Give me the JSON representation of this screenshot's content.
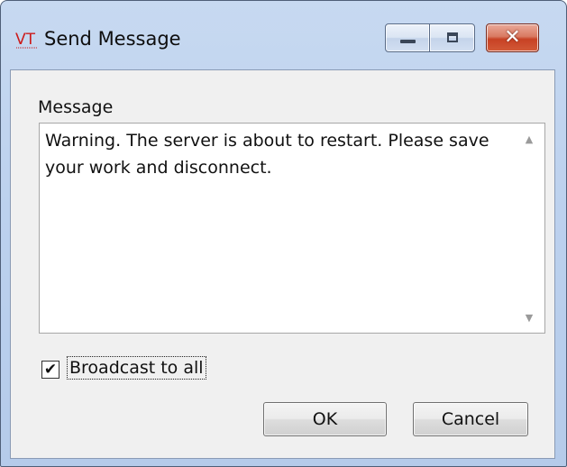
{
  "window": {
    "title": "Send Message",
    "app_icon_text": "VT",
    "close_glyph": "✕"
  },
  "form": {
    "message_label": "Message",
    "message_value": "Warning. The server is about to restart. Please save your work and disconnect.",
    "broadcast_label": "Broadcast to all",
    "broadcast_checked": true,
    "checkbox_mark": "✔",
    "scroll_up_glyph": "▲",
    "scroll_down_glyph": "▼"
  },
  "buttons": {
    "ok_label": "OK",
    "cancel_label": "Cancel"
  },
  "colors": {
    "titlebar": "#c7d9f1",
    "client_bg": "#f0f0f0",
    "close_button": "#c74124",
    "app_icon_red": "#cc1b1b"
  },
  "icons": {
    "app": "vt-logo-icon",
    "minimize": "minimize-icon",
    "maximize": "maximize-icon",
    "close": "close-icon"
  }
}
